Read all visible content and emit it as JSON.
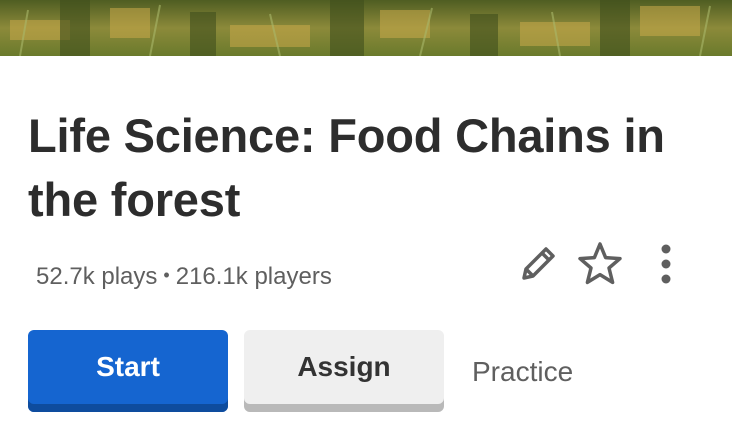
{
  "quiz": {
    "banner_image": "forest-grass-photo",
    "title": "Life Science: Food Chains in the forest",
    "stats": {
      "plays": "52.7k plays",
      "separator": "•",
      "players": "216.1k players"
    }
  },
  "icons": {
    "edit": "pencil-icon",
    "favorite": "star-icon",
    "more": "more-vertical-icon"
  },
  "actions": {
    "start_label": "Start",
    "assign_label": "Assign",
    "practice_label": "Practice"
  },
  "colors": {
    "primary": "#1565d0",
    "primary_shadow": "#0e4c9e",
    "secondary_bg": "#efefef",
    "text_dark": "#2d2d2d",
    "text_muted": "#5f5f5f"
  }
}
